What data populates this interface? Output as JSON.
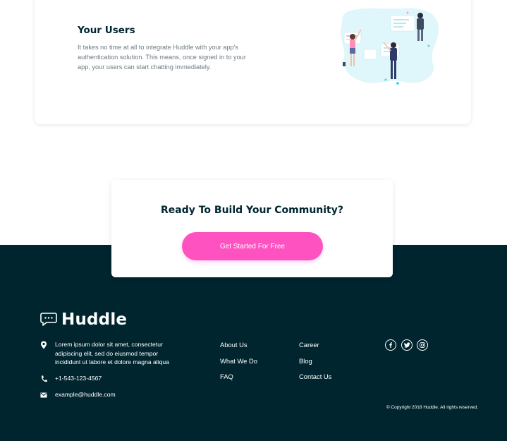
{
  "feature": {
    "title": "Your Users",
    "text": "It takes no time at all to integrate Huddle with your app's authentication solution. This means, once signed in to your app, your users can start chatting immediately."
  },
  "cta": {
    "title": "Ready To Build Your Community?",
    "button_label": "Get Started For Free"
  },
  "footer": {
    "brand": "Huddle",
    "address": "Lorem ipsum dolor sit amet, consectetur adipiscing elit, sed do eiusmod tempor incididunt ut labore et dolore magna aliqua",
    "phone": "+1-543-123-4567",
    "email": "example@huddle.com",
    "links_col1": [
      "About Us",
      "What We Do",
      "FAQ"
    ],
    "links_col2": [
      "Career",
      "Blog",
      "Contact Us"
    ],
    "social_icons": [
      "facebook-icon",
      "twitter-icon",
      "instagram-icon"
    ],
    "copyright": "© Copyright 2018 Huddle. All rights reserved."
  },
  "colors": {
    "dark": "#00252e",
    "accent": "#ff52c1",
    "body_text": "#6b7b80"
  }
}
